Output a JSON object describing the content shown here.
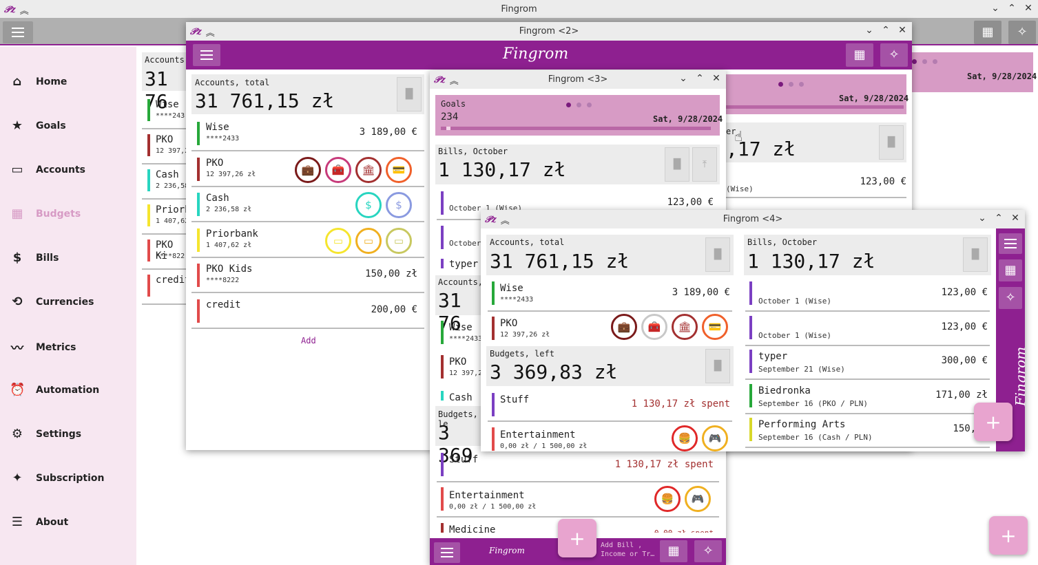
{
  "main": {
    "title": "Fingrom",
    "nav": [
      {
        "label": "Home",
        "icon": "⌂"
      },
      {
        "label": "Goals",
        "icon": "★"
      },
      {
        "label": "Accounts",
        "icon": "▭"
      },
      {
        "label": "Budgets",
        "icon": "▦"
      },
      {
        "label": "Bills",
        "icon": "$"
      },
      {
        "label": "Currencies",
        "icon": "⟲"
      },
      {
        "label": "Metrics",
        "icon": "〰"
      },
      {
        "label": "Automation",
        "icon": "⏰"
      },
      {
        "label": "Settings",
        "icon": "⚙"
      },
      {
        "label": "Subscription",
        "icon": "✦"
      },
      {
        "label": "About",
        "icon": "☰"
      }
    ],
    "date": "Sat, 9/28/2024",
    "bg_accounts_title": "Accounts,",
    "bg_total": "31 76",
    "bg_rows": [
      {
        "name": "Wise",
        "sub": "****243"
      },
      {
        "name": "PKO",
        "sub": "12 397,2"
      },
      {
        "name": "Cash",
        "sub": "2 236,58"
      },
      {
        "name": "Priorba",
        "sub": "1 407,62"
      },
      {
        "name": "PKO Ki",
        "sub": "****822"
      },
      {
        "name": "credit",
        "sub": ""
      }
    ]
  },
  "win2": {
    "title": "Fingrom <2>",
    "brand": "Fingrom",
    "date": "Sat, 9/28/2024",
    "total_tail": ",17 zł",
    "er": "er",
    "rowAmt": "123,00 €",
    "rowSub": "(Wise)",
    "accounts_title": "Accounts, total",
    "accounts_total": "31 761,15 zł",
    "accounts": [
      {
        "name": "Wise",
        "sub": "****2433",
        "amt": "3 189,00 €",
        "color": "#27a83a"
      },
      {
        "name": "PKO",
        "sub": "12 397,26 zł",
        "amt": "",
        "color": "#a33030"
      },
      {
        "name": "Cash",
        "sub": "2 236,58 zł",
        "amt": "",
        "color": "#28d5c0"
      },
      {
        "name": "Priorbank",
        "sub": "1 407,62 zł",
        "amt": "",
        "color": "#f5e52e"
      },
      {
        "name": "PKO Kids",
        "sub": "****8222",
        "amt": "150,00 zł",
        "color": "#e14b4b"
      },
      {
        "name": "credit",
        "sub": "",
        "amt": "200,00 €",
        "color": "#e14b4b"
      }
    ],
    "add": "Add"
  },
  "win3": {
    "title": "Fingrom <3>",
    "goals_label": "Goals",
    "goals_value": "234",
    "date": "Sat, 9/28/2024",
    "bills_title": "Bills, October",
    "bills_total": "1 130,17 zł",
    "bill1_sub": "October 1 (Wise)",
    "bill1_amt": "123,00 €",
    "bill2_sub": "October",
    "bill3": "typer",
    "acc_title": "Accounts,",
    "acc_total": "31 76",
    "wise": "Wise",
    "wise_sub": "****2433",
    "pko": "PKO",
    "pko_sub": "12 397,2",
    "cash": "Cash",
    "budgets_title": "Budgets, le",
    "budgets_total": "3 369",
    "stuff": "Stuff",
    "stuff_amt": "1 130,17 zł spent",
    "ent": "Entertainment",
    "ent_sub": "0,00 zł / 1 500,00 zł",
    "med": "Medicine",
    "med_amt": "0,00 zł spent",
    "brand": "Fingrom",
    "add_label": "Add Bill ,\nIncome or Tr…"
  },
  "win4": {
    "title": "Fingrom <4>",
    "brand": "Fingrom",
    "acc_title": "Accounts, total",
    "acc_total": "31 761,15 zł",
    "wise": "Wise",
    "wise_sub": "****2433",
    "wise_amt": "3 189,00 €",
    "pko": "PKO",
    "pko_sub": "12 397,26 zł",
    "budgets_title": "Budgets, left",
    "budgets_total": "3 369,83 zł",
    "stuff": "Stuff",
    "stuff_amt": "1 130,17 zł spent",
    "ent": "Entertainment",
    "ent_sub": "0,00 zł / 1 500,00 zł",
    "bills_title": "Bills, October",
    "bills_total": "1 130,17 zł",
    "bills": [
      {
        "name": "",
        "sub": "October 1 (Wise)",
        "amt": "123,00 €",
        "color": "#7b3fc2"
      },
      {
        "name": "",
        "sub": "October 1 (Wise)",
        "amt": "123,00 €",
        "color": "#7b3fc2"
      },
      {
        "name": "typer",
        "sub": "September 21 (Wise)",
        "amt": "300,00 €",
        "color": "#7b3fc2"
      },
      {
        "name": "Biedronka",
        "sub": "September 16 (PKO / PLN)",
        "amt": "171,00 zł",
        "color": "#27a83a"
      },
      {
        "name": "Performing Arts",
        "sub": "September 16 (Cash / PLN)",
        "amt": "150,00",
        "color": "#d8d82a"
      }
    ]
  }
}
